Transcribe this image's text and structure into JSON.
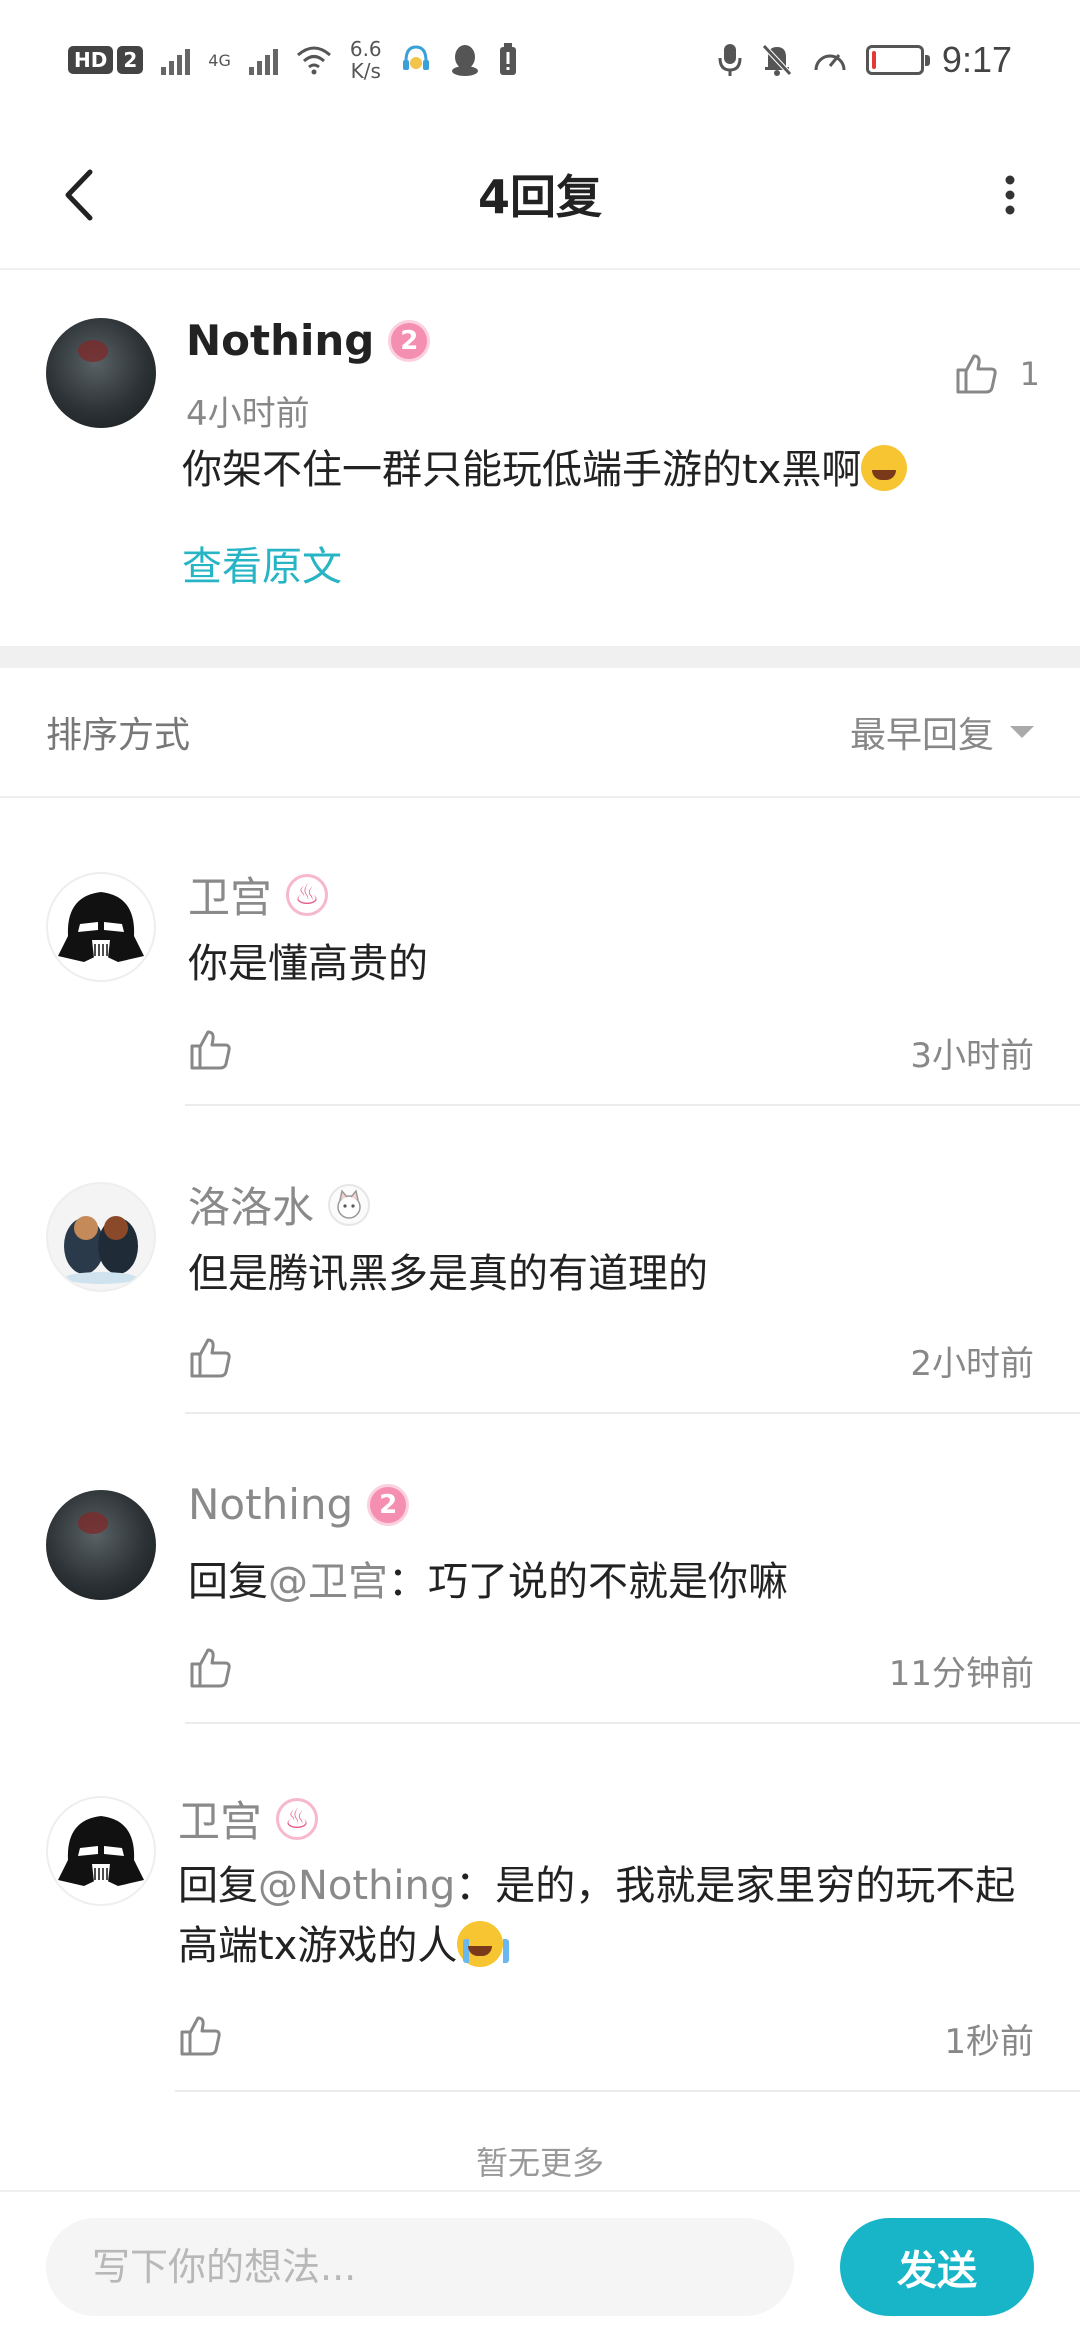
{
  "status_bar": {
    "hd_label": "HD",
    "sim_label": "2",
    "net_label": "4G",
    "speed_value": "6.6",
    "speed_unit": "K/s",
    "time": "9:17",
    "icons": [
      "hd-icon",
      "signal-icon",
      "wifi-icon",
      "app-notification-icon",
      "qq-icon",
      "battery-alert-icon",
      "mic-icon",
      "mute-bell-icon",
      "speedometer-icon",
      "battery-icon"
    ],
    "battery_level": 0.08,
    "battery_color": "#e53935"
  },
  "nav": {
    "title": "4回复",
    "back_icon": "chevron-left-icon",
    "more_icon": "more-vertical-icon"
  },
  "root_comment": {
    "author": "Nothing",
    "level": "2",
    "time": "4小时前",
    "text": "你架不住一群只能玩低端手游的tx黑啊",
    "emoji": "rolling-laugh-emoji",
    "likes": "1",
    "view_original": "查看原文"
  },
  "sort": {
    "label": "排序方式",
    "selected": "最早回复"
  },
  "replies": [
    {
      "author": "卫宫",
      "badge": "fire-badge",
      "text": "你是懂高贵的",
      "time": "3小时前"
    },
    {
      "author": "洛洛水",
      "badge": "anime-badge",
      "text": "但是腾讯黑多是真的有道理的",
      "time": "2小时前"
    },
    {
      "author": "Nothing",
      "badge": "level-badge",
      "level": "2",
      "reply_prefix": "回复",
      "reply_to": "@卫宫",
      "text": "：巧了说的不就是你嘛",
      "time": "11分钟前"
    },
    {
      "author": "卫宫",
      "badge": "fire-badge",
      "reply_prefix": "回复",
      "reply_to": "@Nothing",
      "text": "：是的，我就是家里穷的玩不起高端tx游戏的人",
      "emoji": "crying-emoji",
      "time": "1秒前"
    }
  ],
  "no_more": "暂无更多",
  "composer": {
    "placeholder": "写下你的想法...",
    "send_label": "发送"
  },
  "colors": {
    "accent": "#17b5c7",
    "link": "#27b4c4",
    "level_badge": "#f48fb1"
  }
}
